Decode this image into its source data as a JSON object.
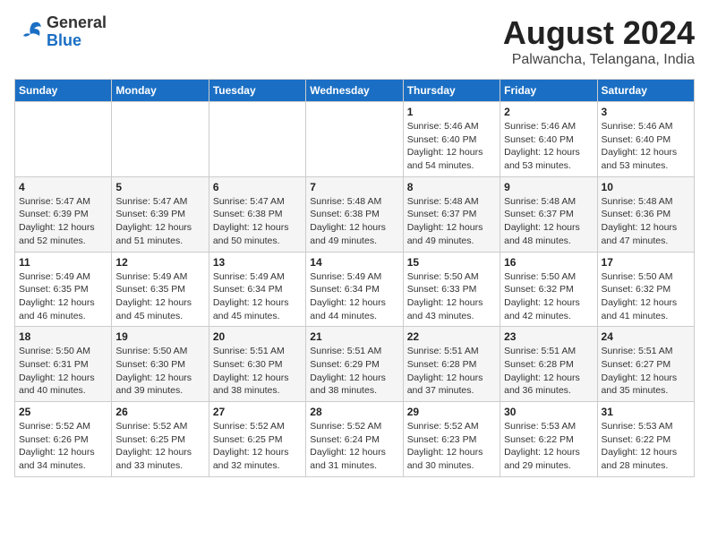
{
  "logo": {
    "text_general": "General",
    "text_blue": "Blue"
  },
  "title": "August 2024",
  "subtitle": "Palwancha, Telangana, India",
  "days_of_week": [
    "Sunday",
    "Monday",
    "Tuesday",
    "Wednesday",
    "Thursday",
    "Friday",
    "Saturday"
  ],
  "weeks": [
    [
      {
        "day": "",
        "info": ""
      },
      {
        "day": "",
        "info": ""
      },
      {
        "day": "",
        "info": ""
      },
      {
        "day": "",
        "info": ""
      },
      {
        "day": "1",
        "info": "Sunrise: 5:46 AM\nSunset: 6:40 PM\nDaylight: 12 hours\nand 54 minutes."
      },
      {
        "day": "2",
        "info": "Sunrise: 5:46 AM\nSunset: 6:40 PM\nDaylight: 12 hours\nand 53 minutes."
      },
      {
        "day": "3",
        "info": "Sunrise: 5:46 AM\nSunset: 6:40 PM\nDaylight: 12 hours\nand 53 minutes."
      }
    ],
    [
      {
        "day": "4",
        "info": "Sunrise: 5:47 AM\nSunset: 6:39 PM\nDaylight: 12 hours\nand 52 minutes."
      },
      {
        "day": "5",
        "info": "Sunrise: 5:47 AM\nSunset: 6:39 PM\nDaylight: 12 hours\nand 51 minutes."
      },
      {
        "day": "6",
        "info": "Sunrise: 5:47 AM\nSunset: 6:38 PM\nDaylight: 12 hours\nand 50 minutes."
      },
      {
        "day": "7",
        "info": "Sunrise: 5:48 AM\nSunset: 6:38 PM\nDaylight: 12 hours\nand 49 minutes."
      },
      {
        "day": "8",
        "info": "Sunrise: 5:48 AM\nSunset: 6:37 PM\nDaylight: 12 hours\nand 49 minutes."
      },
      {
        "day": "9",
        "info": "Sunrise: 5:48 AM\nSunset: 6:37 PM\nDaylight: 12 hours\nand 48 minutes."
      },
      {
        "day": "10",
        "info": "Sunrise: 5:48 AM\nSunset: 6:36 PM\nDaylight: 12 hours\nand 47 minutes."
      }
    ],
    [
      {
        "day": "11",
        "info": "Sunrise: 5:49 AM\nSunset: 6:35 PM\nDaylight: 12 hours\nand 46 minutes."
      },
      {
        "day": "12",
        "info": "Sunrise: 5:49 AM\nSunset: 6:35 PM\nDaylight: 12 hours\nand 45 minutes."
      },
      {
        "day": "13",
        "info": "Sunrise: 5:49 AM\nSunset: 6:34 PM\nDaylight: 12 hours\nand 45 minutes."
      },
      {
        "day": "14",
        "info": "Sunrise: 5:49 AM\nSunset: 6:34 PM\nDaylight: 12 hours\nand 44 minutes."
      },
      {
        "day": "15",
        "info": "Sunrise: 5:50 AM\nSunset: 6:33 PM\nDaylight: 12 hours\nand 43 minutes."
      },
      {
        "day": "16",
        "info": "Sunrise: 5:50 AM\nSunset: 6:32 PM\nDaylight: 12 hours\nand 42 minutes."
      },
      {
        "day": "17",
        "info": "Sunrise: 5:50 AM\nSunset: 6:32 PM\nDaylight: 12 hours\nand 41 minutes."
      }
    ],
    [
      {
        "day": "18",
        "info": "Sunrise: 5:50 AM\nSunset: 6:31 PM\nDaylight: 12 hours\nand 40 minutes."
      },
      {
        "day": "19",
        "info": "Sunrise: 5:50 AM\nSunset: 6:30 PM\nDaylight: 12 hours\nand 39 minutes."
      },
      {
        "day": "20",
        "info": "Sunrise: 5:51 AM\nSunset: 6:30 PM\nDaylight: 12 hours\nand 38 minutes."
      },
      {
        "day": "21",
        "info": "Sunrise: 5:51 AM\nSunset: 6:29 PM\nDaylight: 12 hours\nand 38 minutes."
      },
      {
        "day": "22",
        "info": "Sunrise: 5:51 AM\nSunset: 6:28 PM\nDaylight: 12 hours\nand 37 minutes."
      },
      {
        "day": "23",
        "info": "Sunrise: 5:51 AM\nSunset: 6:28 PM\nDaylight: 12 hours\nand 36 minutes."
      },
      {
        "day": "24",
        "info": "Sunrise: 5:51 AM\nSunset: 6:27 PM\nDaylight: 12 hours\nand 35 minutes."
      }
    ],
    [
      {
        "day": "25",
        "info": "Sunrise: 5:52 AM\nSunset: 6:26 PM\nDaylight: 12 hours\nand 34 minutes."
      },
      {
        "day": "26",
        "info": "Sunrise: 5:52 AM\nSunset: 6:25 PM\nDaylight: 12 hours\nand 33 minutes."
      },
      {
        "day": "27",
        "info": "Sunrise: 5:52 AM\nSunset: 6:25 PM\nDaylight: 12 hours\nand 32 minutes."
      },
      {
        "day": "28",
        "info": "Sunrise: 5:52 AM\nSunset: 6:24 PM\nDaylight: 12 hours\nand 31 minutes."
      },
      {
        "day": "29",
        "info": "Sunrise: 5:52 AM\nSunset: 6:23 PM\nDaylight: 12 hours\nand 30 minutes."
      },
      {
        "day": "30",
        "info": "Sunrise: 5:53 AM\nSunset: 6:22 PM\nDaylight: 12 hours\nand 29 minutes."
      },
      {
        "day": "31",
        "info": "Sunrise: 5:53 AM\nSunset: 6:22 PM\nDaylight: 12 hours\nand 28 minutes."
      }
    ]
  ]
}
